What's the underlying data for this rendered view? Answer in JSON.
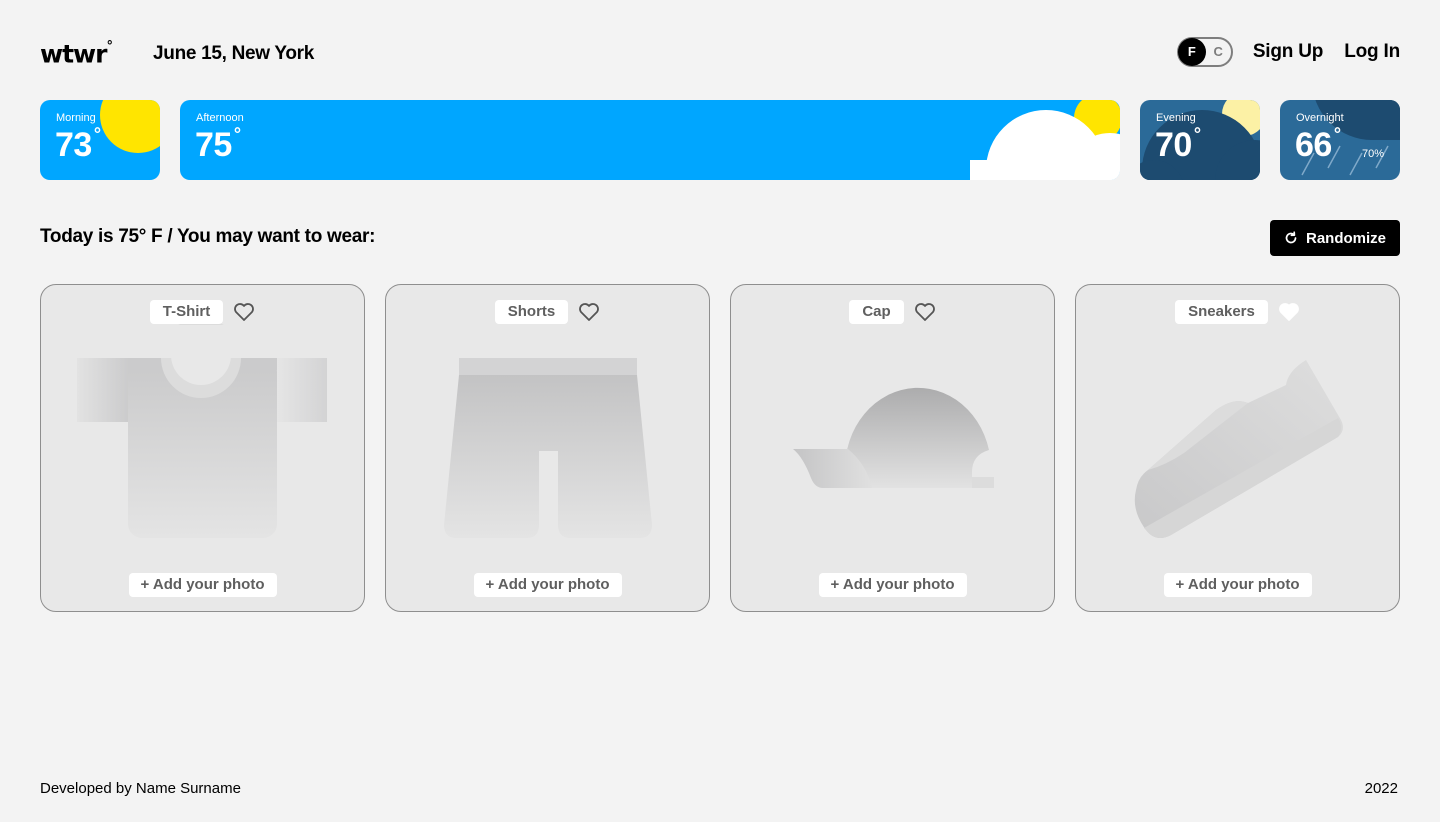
{
  "header": {
    "logo": "wtwr",
    "logo_degree": "°",
    "date_location": "June 15, New York",
    "unit_toggle": {
      "options": [
        "F",
        "C"
      ],
      "selected": "F"
    },
    "sign_up": "Sign Up",
    "log_in": "Log In"
  },
  "forecast": [
    {
      "period": "Morning",
      "temp": "73",
      "degree": "°",
      "condition": "sunny"
    },
    {
      "period": "Afternoon",
      "temp": "75",
      "degree": "°",
      "condition": "partly-cloudy"
    },
    {
      "period": "Evening",
      "temp": "70",
      "degree": "°",
      "condition": "cloudy-evening"
    },
    {
      "period": "Overnight",
      "temp": "66",
      "degree": "°",
      "condition": "rain",
      "precipitation": "70%"
    }
  ],
  "suggestion": {
    "text": "Today is 75° F / You may want to wear:",
    "randomize_label": "Randomize"
  },
  "items": [
    {
      "name": "T-Shirt",
      "liked": false,
      "add_photo": "+ Add your photo",
      "icon": "tshirt-icon"
    },
    {
      "name": "Shorts",
      "liked": false,
      "add_photo": "+ Add your photo",
      "icon": "shorts-icon"
    },
    {
      "name": "Cap",
      "liked": false,
      "add_photo": "+ Add your photo",
      "icon": "cap-icon"
    },
    {
      "name": "Sneakers",
      "liked": true,
      "add_photo": "+ Add your photo",
      "icon": "sneakers-icon"
    }
  ],
  "footer": {
    "credit": "Developed by Name Surname",
    "year": "2022"
  },
  "colors": {
    "day_sky": "#00a6ff",
    "night_sky": "#2b6a98",
    "sun": "#ffe500",
    "accent": "#000000"
  }
}
